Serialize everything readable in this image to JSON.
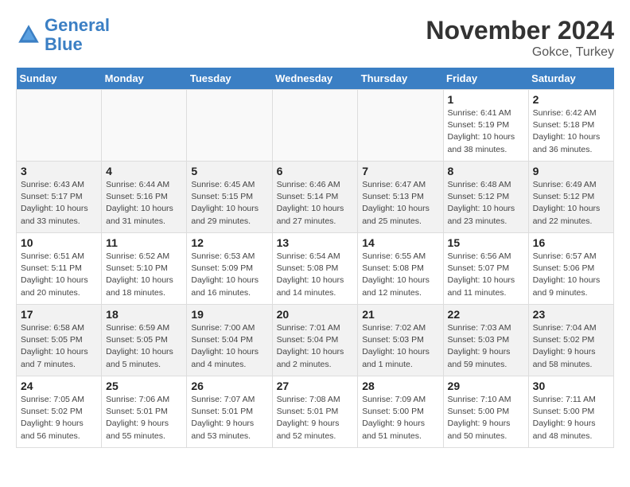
{
  "logo": {
    "text_general": "General",
    "text_blue": "Blue"
  },
  "header": {
    "title": "November 2024",
    "subtitle": "Gokce, Turkey"
  },
  "weekdays": [
    "Sunday",
    "Monday",
    "Tuesday",
    "Wednesday",
    "Thursday",
    "Friday",
    "Saturday"
  ],
  "weeks": [
    [
      {
        "day": "",
        "info": ""
      },
      {
        "day": "",
        "info": ""
      },
      {
        "day": "",
        "info": ""
      },
      {
        "day": "",
        "info": ""
      },
      {
        "day": "",
        "info": ""
      },
      {
        "day": "1",
        "info": "Sunrise: 6:41 AM\nSunset: 5:19 PM\nDaylight: 10 hours\nand 38 minutes."
      },
      {
        "day": "2",
        "info": "Sunrise: 6:42 AM\nSunset: 5:18 PM\nDaylight: 10 hours\nand 36 minutes."
      }
    ],
    [
      {
        "day": "3",
        "info": "Sunrise: 6:43 AM\nSunset: 5:17 PM\nDaylight: 10 hours\nand 33 minutes."
      },
      {
        "day": "4",
        "info": "Sunrise: 6:44 AM\nSunset: 5:16 PM\nDaylight: 10 hours\nand 31 minutes."
      },
      {
        "day": "5",
        "info": "Sunrise: 6:45 AM\nSunset: 5:15 PM\nDaylight: 10 hours\nand 29 minutes."
      },
      {
        "day": "6",
        "info": "Sunrise: 6:46 AM\nSunset: 5:14 PM\nDaylight: 10 hours\nand 27 minutes."
      },
      {
        "day": "7",
        "info": "Sunrise: 6:47 AM\nSunset: 5:13 PM\nDaylight: 10 hours\nand 25 minutes."
      },
      {
        "day": "8",
        "info": "Sunrise: 6:48 AM\nSunset: 5:12 PM\nDaylight: 10 hours\nand 23 minutes."
      },
      {
        "day": "9",
        "info": "Sunrise: 6:49 AM\nSunset: 5:12 PM\nDaylight: 10 hours\nand 22 minutes."
      }
    ],
    [
      {
        "day": "10",
        "info": "Sunrise: 6:51 AM\nSunset: 5:11 PM\nDaylight: 10 hours\nand 20 minutes."
      },
      {
        "day": "11",
        "info": "Sunrise: 6:52 AM\nSunset: 5:10 PM\nDaylight: 10 hours\nand 18 minutes."
      },
      {
        "day": "12",
        "info": "Sunrise: 6:53 AM\nSunset: 5:09 PM\nDaylight: 10 hours\nand 16 minutes."
      },
      {
        "day": "13",
        "info": "Sunrise: 6:54 AM\nSunset: 5:08 PM\nDaylight: 10 hours\nand 14 minutes."
      },
      {
        "day": "14",
        "info": "Sunrise: 6:55 AM\nSunset: 5:08 PM\nDaylight: 10 hours\nand 12 minutes."
      },
      {
        "day": "15",
        "info": "Sunrise: 6:56 AM\nSunset: 5:07 PM\nDaylight: 10 hours\nand 11 minutes."
      },
      {
        "day": "16",
        "info": "Sunrise: 6:57 AM\nSunset: 5:06 PM\nDaylight: 10 hours\nand 9 minutes."
      }
    ],
    [
      {
        "day": "17",
        "info": "Sunrise: 6:58 AM\nSunset: 5:05 PM\nDaylight: 10 hours\nand 7 minutes."
      },
      {
        "day": "18",
        "info": "Sunrise: 6:59 AM\nSunset: 5:05 PM\nDaylight: 10 hours\nand 5 minutes."
      },
      {
        "day": "19",
        "info": "Sunrise: 7:00 AM\nSunset: 5:04 PM\nDaylight: 10 hours\nand 4 minutes."
      },
      {
        "day": "20",
        "info": "Sunrise: 7:01 AM\nSunset: 5:04 PM\nDaylight: 10 hours\nand 2 minutes."
      },
      {
        "day": "21",
        "info": "Sunrise: 7:02 AM\nSunset: 5:03 PM\nDaylight: 10 hours\nand 1 minute."
      },
      {
        "day": "22",
        "info": "Sunrise: 7:03 AM\nSunset: 5:03 PM\nDaylight: 9 hours\nand 59 minutes."
      },
      {
        "day": "23",
        "info": "Sunrise: 7:04 AM\nSunset: 5:02 PM\nDaylight: 9 hours\nand 58 minutes."
      }
    ],
    [
      {
        "day": "24",
        "info": "Sunrise: 7:05 AM\nSunset: 5:02 PM\nDaylight: 9 hours\nand 56 minutes."
      },
      {
        "day": "25",
        "info": "Sunrise: 7:06 AM\nSunset: 5:01 PM\nDaylight: 9 hours\nand 55 minutes."
      },
      {
        "day": "26",
        "info": "Sunrise: 7:07 AM\nSunset: 5:01 PM\nDaylight: 9 hours\nand 53 minutes."
      },
      {
        "day": "27",
        "info": "Sunrise: 7:08 AM\nSunset: 5:01 PM\nDaylight: 9 hours\nand 52 minutes."
      },
      {
        "day": "28",
        "info": "Sunrise: 7:09 AM\nSunset: 5:00 PM\nDaylight: 9 hours\nand 51 minutes."
      },
      {
        "day": "29",
        "info": "Sunrise: 7:10 AM\nSunset: 5:00 PM\nDaylight: 9 hours\nand 50 minutes."
      },
      {
        "day": "30",
        "info": "Sunrise: 7:11 AM\nSunset: 5:00 PM\nDaylight: 9 hours\nand 48 minutes."
      }
    ]
  ]
}
